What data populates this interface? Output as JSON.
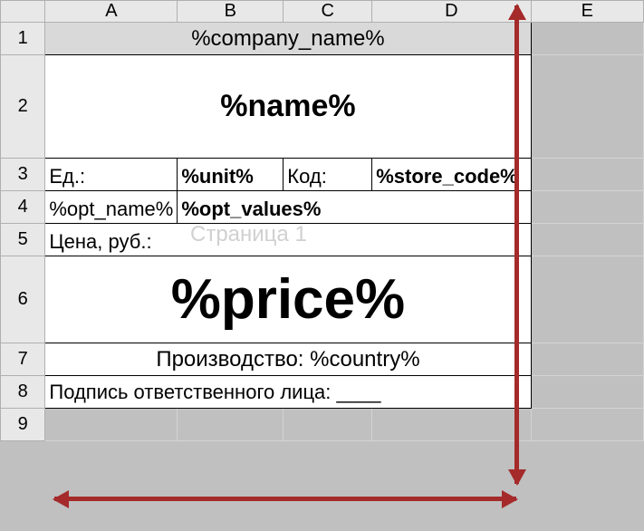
{
  "columns": {
    "A": "A",
    "B": "B",
    "C": "C",
    "D": "D",
    "E": "E"
  },
  "rows": {
    "r1": "1",
    "r2": "2",
    "r3": "3",
    "r4": "4",
    "r5": "5",
    "r6": "6",
    "r7": "7",
    "r8": "8",
    "r9": "9"
  },
  "watermark": "Страница 1",
  "template": {
    "company_name": "%company_name%",
    "name": "%name%",
    "unit_label": "Ед.:",
    "unit_value": "%unit%",
    "code_label": "Код:",
    "store_code": "%store_code%",
    "opt_name": "%opt_name%",
    "opt_values": "%opt_values%",
    "price_label": "Цена, руб.:",
    "price": "%price%",
    "country_line": "Производство: %country%",
    "sign_line": "Подпись ответственного лица: ____"
  }
}
